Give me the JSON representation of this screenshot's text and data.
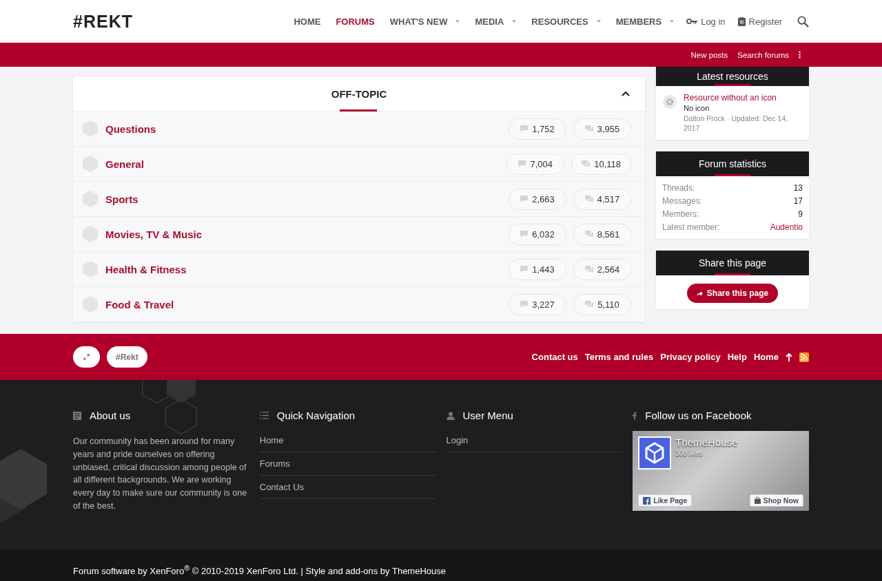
{
  "header": {
    "logo": "#REKT",
    "nav": [
      {
        "label": "HOME",
        "selected": false,
        "dropdown": false
      },
      {
        "label": "FORUMS",
        "selected": true,
        "dropdown": false
      },
      {
        "label": "WHAT'S NEW",
        "selected": false,
        "dropdown": true
      },
      {
        "label": "MEDIA",
        "selected": false,
        "dropdown": true
      },
      {
        "label": "RESOURCES",
        "selected": false,
        "dropdown": true
      },
      {
        "label": "MEMBERS",
        "selected": false,
        "dropdown": true
      }
    ],
    "login": "Log in",
    "register": "Register"
  },
  "subnav": {
    "links": [
      "New posts",
      "Search forums"
    ]
  },
  "category": {
    "title": "OFF-TOPIC",
    "expanded": true,
    "forums": [
      {
        "name": "Questions",
        "threads": "1,752",
        "messages": "3,955"
      },
      {
        "name": "General",
        "threads": "7,004",
        "messages": "10,118"
      },
      {
        "name": "Sports",
        "threads": "2,663",
        "messages": "4,517"
      },
      {
        "name": "Movies, TV & Music",
        "threads": "6,032",
        "messages": "8,561"
      },
      {
        "name": "Health & Fitness",
        "threads": "1,443",
        "messages": "2,564"
      },
      {
        "name": "Food & Travel",
        "threads": "3,227",
        "messages": "5,110"
      }
    ]
  },
  "sidebar": {
    "latest_resources": {
      "title": "Latest resources",
      "resource": {
        "name": "Resource without an icon",
        "tagline": "No icon",
        "meta": "Dalton Prock · Updated: Dec 14, 2017"
      }
    },
    "statistics": {
      "title": "Forum statistics",
      "rows": [
        {
          "label": "Threads:",
          "value": "13",
          "kind": "plain"
        },
        {
          "label": "Messages:",
          "value": "17",
          "kind": "plain"
        },
        {
          "label": "Members:",
          "value": "9",
          "kind": "plain"
        },
        {
          "label": "Latest member:",
          "value": "Audentio",
          "kind": "link"
        }
      ]
    },
    "share": {
      "title": "Share this page",
      "button": "Share this page"
    }
  },
  "footer_bar": {
    "style_chooser": "#Rekt",
    "links": [
      "Contact us",
      "Terms and rules",
      "Privacy policy",
      "Help",
      "Home"
    ]
  },
  "footer": {
    "about": {
      "title": "About us",
      "text": "Our community has been around for many years and pride ourselves on offering unbiased, critical discussion among people of all different backgrounds. We are working every day to make sure our community is one of the best."
    },
    "quick_nav": {
      "title": "Quick Navigation",
      "links": [
        "Home",
        "Forums",
        "Contact Us"
      ]
    },
    "user_menu": {
      "title": "User Menu",
      "links": [
        "Login"
      ]
    },
    "facebook": {
      "title": "Follow us on Facebook",
      "page_name": "ThemeHouse",
      "likes": "308 likes",
      "like_button": "Like Page",
      "shop_button": "Shop Now"
    }
  },
  "copyright": "Forum software by XenForo$^{®}$ © 2010-2019 XenForo Ltd. | Style and add-ons by ThemeHouse"
}
